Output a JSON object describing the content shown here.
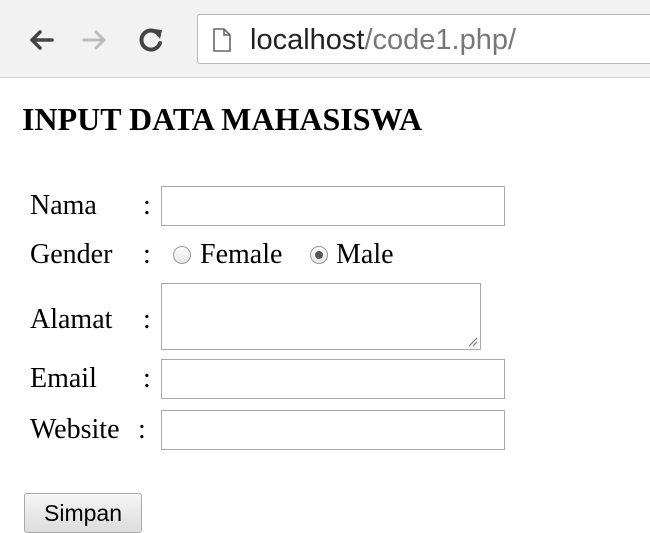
{
  "browser": {
    "url_host": "localhost",
    "url_path": "/code1.php/"
  },
  "page": {
    "title": "INPUT DATA MAHASISWA"
  },
  "form": {
    "separator": ":",
    "nama_label": "Nama",
    "nama_value": "",
    "gender_label": "Gender",
    "gender_options": [
      "Female",
      "Male"
    ],
    "gender_selected": "Male",
    "alamat_label": "Alamat",
    "alamat_value": "",
    "email_label": "Email",
    "email_value": "",
    "website_label": "Website",
    "website_value": "",
    "submit_label": "Simpan"
  },
  "icons": [
    "back-arrow-icon",
    "forward-arrow-icon",
    "reload-icon",
    "page-document-icon",
    "resize-grip-icon"
  ]
}
